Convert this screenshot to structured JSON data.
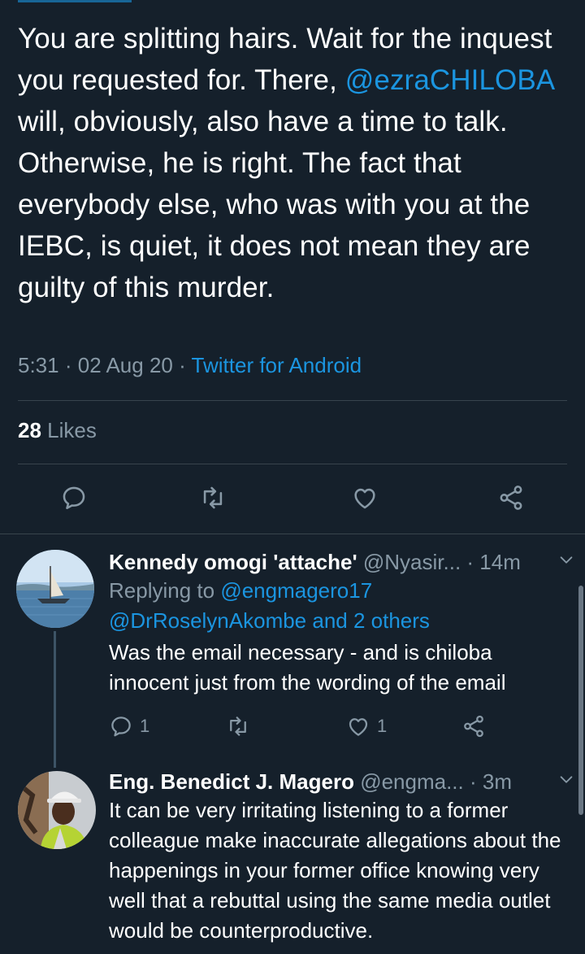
{
  "main_tweet": {
    "text_parts": {
      "p1": "You are splitting hairs. Wait for the inquest you requested for. There, ",
      "mention": "@ezraCHILOBA",
      "p2": " will, obviously, also have a time to talk. Otherwise, he is right. The fact that everybody else, who was with you at the IEBC, is quiet, it does not mean they are guilty of this murder."
    },
    "time": "5:31",
    "date": "02 Aug 20",
    "separator": "·",
    "client": "Twitter for Android",
    "likes_count": "28",
    "likes_label": "Likes"
  },
  "replies": [
    {
      "name": "Kennedy omogi 'attache'",
      "handle": "@Nyasir...",
      "time": "· 14m",
      "replying_prefix": "Replying to ",
      "replying_to_1": "@engmagero17",
      "replying_to_2": "@DrRoselynAkombe and 2 others",
      "text": "Was the email necessary - and is chiloba innocent just from the wording of the email",
      "reply_count": "1",
      "like_count": "1",
      "avatar_icon": "boat-sail-lake-avatar"
    },
    {
      "name": "Eng. Benedict  J. Magero",
      "handle": "@engma...",
      "time": "· 3m",
      "text": "It can be very irritating listening to a former colleague make inaccurate allegations about the happenings in your former office knowing very well that a rebuttal using the same media outlet would be counterproductive.",
      "avatar_icon": "person-hardhat-avatar"
    }
  ],
  "colors": {
    "background": "#15202b",
    "accent": "#1b95e0",
    "secondary_text": "#8899a6",
    "divider": "#38444d"
  },
  "icons": [
    "reply-icon",
    "retweet-icon",
    "like-icon",
    "share-icon",
    "chevron-down-icon"
  ]
}
